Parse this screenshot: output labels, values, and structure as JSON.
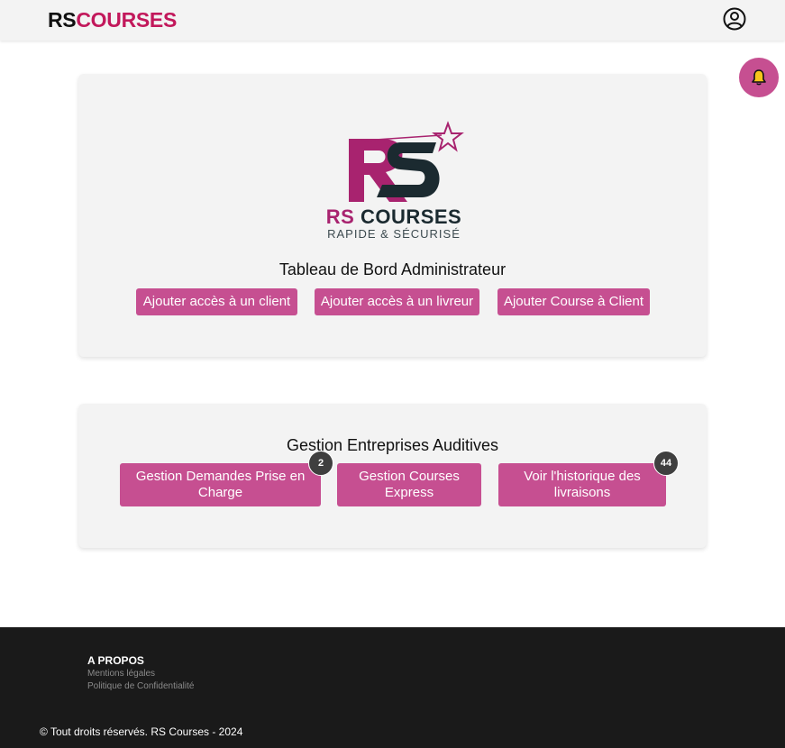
{
  "header": {
    "brand_prefix": "RS",
    "brand_suffix": "COURSES",
    "profile_icon": "user-circle-icon"
  },
  "notifications": {
    "icon": "bell-icon"
  },
  "logo": {
    "text_part1": "RS",
    "text_part2": "COURSES",
    "tagline": "RAPIDE & SÉCURISÉ",
    "brand_color": "#a8236f",
    "dark_color": "#1b2a30"
  },
  "admin_card": {
    "title": "Tableau de Bord Administrateur",
    "buttons": [
      {
        "label": "Ajouter accès à un client"
      },
      {
        "label": "Ajouter accès à un livreur"
      },
      {
        "label": "Ajouter Course à Client"
      }
    ]
  },
  "auditive_card": {
    "title": "Gestion Entreprises Auditives",
    "buttons": [
      {
        "label": "Gestion Demandes Prise en Charge",
        "badge": "2"
      },
      {
        "label": "Gestion Courses Express"
      },
      {
        "label": "Voir l'historique des livraisons",
        "badge": "44"
      }
    ]
  },
  "footer": {
    "heading": "A PROPOS",
    "links": [
      "Mentions légales",
      "Politique de Confidentialité"
    ],
    "copyright": "© Tout droits réservés. RS Courses - 2024"
  },
  "colors": {
    "accent": "#c64f91",
    "brand_pink": "#c2185b",
    "footer_bg": "#1a1a1a",
    "card_bg": "#f3f3f3",
    "badge_bg": "#3f3f3f"
  }
}
